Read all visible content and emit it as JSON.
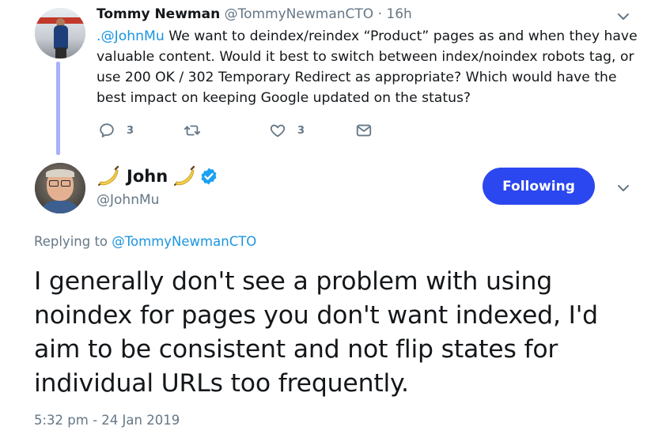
{
  "parent_tweet": {
    "name": "Tommy Newman",
    "handle": "@TommyNewmanCTO",
    "separator": "·",
    "time": "16h",
    "mention": ".@JohnMu",
    "text": " We want to deindex/reindex “Product” pages as and when they have valuable content. Would it best to switch between index/noindex robots tag, or use 200  OK / 302 Temporary Redirect as appropriate? Which would have the best impact on keeping Google updated on the status?",
    "actions": {
      "reply_icon": "reply-icon",
      "reply_count": "3",
      "retweet_icon": "retweet-icon",
      "like_icon": "heart-icon",
      "like_count": "3",
      "dm_icon": "envelope-icon"
    }
  },
  "main_tweet": {
    "name": "John",
    "name_emoji": "🍌",
    "verified_icon": "verified-badge-icon",
    "handle": "@JohnMu",
    "follow_button": "Following",
    "replying_prefix": "Replying to ",
    "replying_to": "@TommyNewmanCTO",
    "text": "I generally don't see a problem with using noindex for pages you don't want indexed, I'd aim to be consistent and not flip states for individual URLs too frequently.",
    "timestamp": "5:32 pm - 24 Jan 2019"
  },
  "colors": {
    "accent_blue": "#1b95e0",
    "follow_button_bg": "#2b47ef",
    "thread_line": "#a9b2f7",
    "secondary_text": "#657786",
    "primary_text": "#14171a"
  }
}
